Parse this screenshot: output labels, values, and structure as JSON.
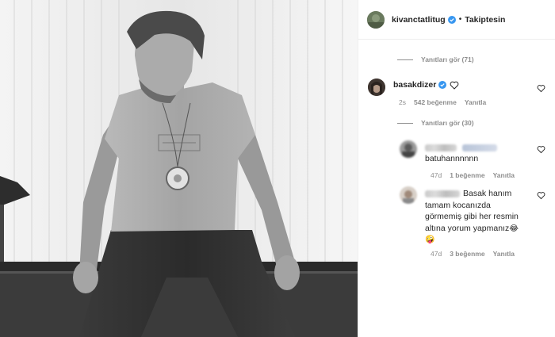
{
  "post": {
    "author": "kivanctatlitug",
    "follow_status": "Takiptesin",
    "dot": "•"
  },
  "replies_top": "Yanıtları gör (71)",
  "comment_main": {
    "username": "basakdizer",
    "age": "2s",
    "likes": "542 beğenme",
    "reply": "Yanıtla",
    "replies_link": "Yanıtları gör (30)"
  },
  "reply_1": {
    "text": "batuhannnnnn",
    "age": "47d",
    "likes": "1 beğenme",
    "reply": "Yanıtla"
  },
  "reply_2": {
    "lines": [
      "Basak hanım",
      "tamam kocanızda",
      "görmemiş gibi her resmin",
      "altına yorum yapmanız"
    ],
    "emoji_laugh": "😂",
    "emoji_dizzy": "🤪",
    "age": "47d",
    "likes": "3 beğenme",
    "reply": "Yanıtla"
  },
  "icons": {
    "verified": "verified-badge-icon",
    "heart": "heart-outline-icon"
  },
  "colors": {
    "verified_blue": "#3897f0",
    "muted": "#8e8e8e",
    "text": "#262626"
  }
}
